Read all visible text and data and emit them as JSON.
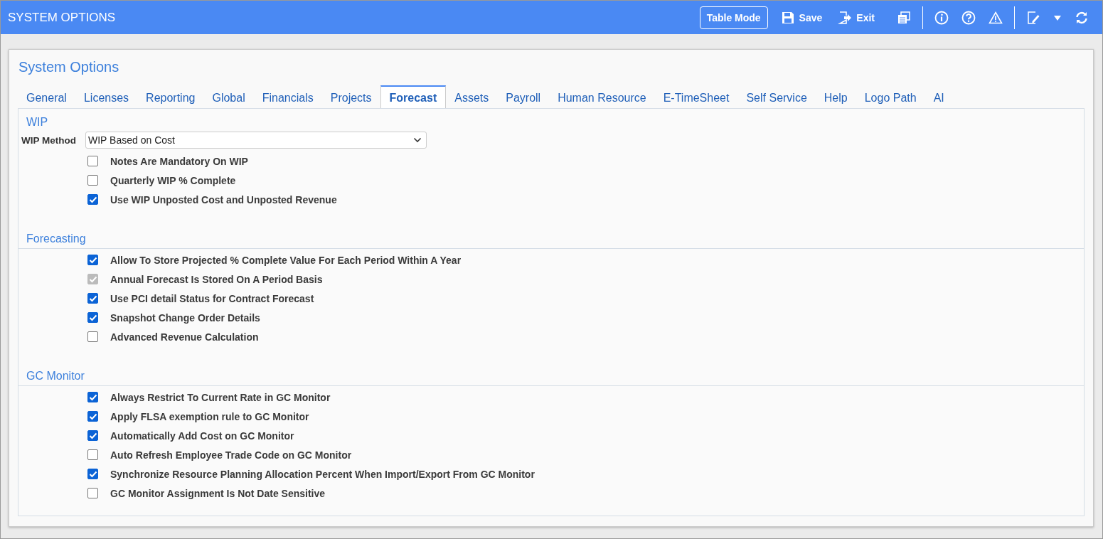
{
  "window": {
    "title": "SYSTEM OPTIONS"
  },
  "toolbar": [
    {
      "kind": "outline",
      "label": "Table Mode"
    },
    {
      "kind": "save",
      "label": "Save"
    },
    {
      "kind": "exit",
      "label": "Exit"
    },
    {
      "kind": "windows"
    },
    {
      "kind": "separator"
    },
    {
      "kind": "info"
    },
    {
      "kind": "help"
    },
    {
      "kind": "warning"
    },
    {
      "kind": "separator"
    },
    {
      "kind": "edit"
    },
    {
      "kind": "caret"
    },
    {
      "kind": "refresh"
    }
  ],
  "page_title": "System Options",
  "tabs": [
    {
      "label": "General",
      "selected": false
    },
    {
      "label": "Licenses",
      "selected": false
    },
    {
      "label": "Reporting",
      "selected": false
    },
    {
      "label": "Global",
      "selected": false
    },
    {
      "label": "Financials",
      "selected": false
    },
    {
      "label": "Projects",
      "selected": false
    },
    {
      "label": "Forecast",
      "selected": true
    },
    {
      "label": "Assets",
      "selected": false
    },
    {
      "label": "Payroll",
      "selected": false
    },
    {
      "label": "Human Resource",
      "selected": false
    },
    {
      "label": "E-TimeSheet",
      "selected": false
    },
    {
      "label": "Self Service",
      "selected": false
    },
    {
      "label": "Help",
      "selected": false
    },
    {
      "label": "Logo Path",
      "selected": false
    },
    {
      "label": "AI",
      "selected": false
    }
  ],
  "sections": [
    {
      "title": "WIP",
      "divider": false,
      "field": {
        "label": "WIP Method",
        "value": "WIP Based on Cost"
      },
      "options": [
        {
          "label": "Notes Are Mandatory On WIP",
          "checked": false,
          "disabled": false
        },
        {
          "label": "Quarterly WIP % Complete",
          "checked": false,
          "disabled": false
        },
        {
          "label": "Use WIP Unposted Cost and Unposted Revenue",
          "checked": true,
          "disabled": false
        }
      ]
    },
    {
      "title": "Forecasting",
      "divider": true,
      "options": [
        {
          "label": "Allow To Store Projected % Complete Value For Each Period Within A Year",
          "checked": true,
          "disabled": false
        },
        {
          "label": "Annual Forecast Is Stored On A Period Basis",
          "checked": true,
          "disabled": true
        },
        {
          "label": "Use PCI detail Status for Contract Forecast",
          "checked": true,
          "disabled": false
        },
        {
          "label": "Snapshot Change Order Details",
          "checked": true,
          "disabled": false
        },
        {
          "label": "Advanced Revenue Calculation",
          "checked": false,
          "disabled": false
        }
      ]
    },
    {
      "title": "GC Monitor",
      "divider": true,
      "options": [
        {
          "label": "Always Restrict To Current Rate in GC Monitor",
          "checked": true,
          "disabled": false
        },
        {
          "label": "Apply FLSA exemption rule to GC Monitor",
          "checked": true,
          "disabled": false
        },
        {
          "label": "Automatically Add Cost on GC Monitor",
          "checked": true,
          "disabled": false
        },
        {
          "label": "Auto Refresh Employee Trade Code on GC Monitor",
          "checked": false,
          "disabled": false
        },
        {
          "label": "Synchronize Resource Planning Allocation Percent When Import/Export From GC Monitor",
          "checked": true,
          "disabled": false
        },
        {
          "label": "GC Monitor Assignment Is Not Date Sensitive",
          "checked": false,
          "disabled": false
        }
      ]
    }
  ]
}
